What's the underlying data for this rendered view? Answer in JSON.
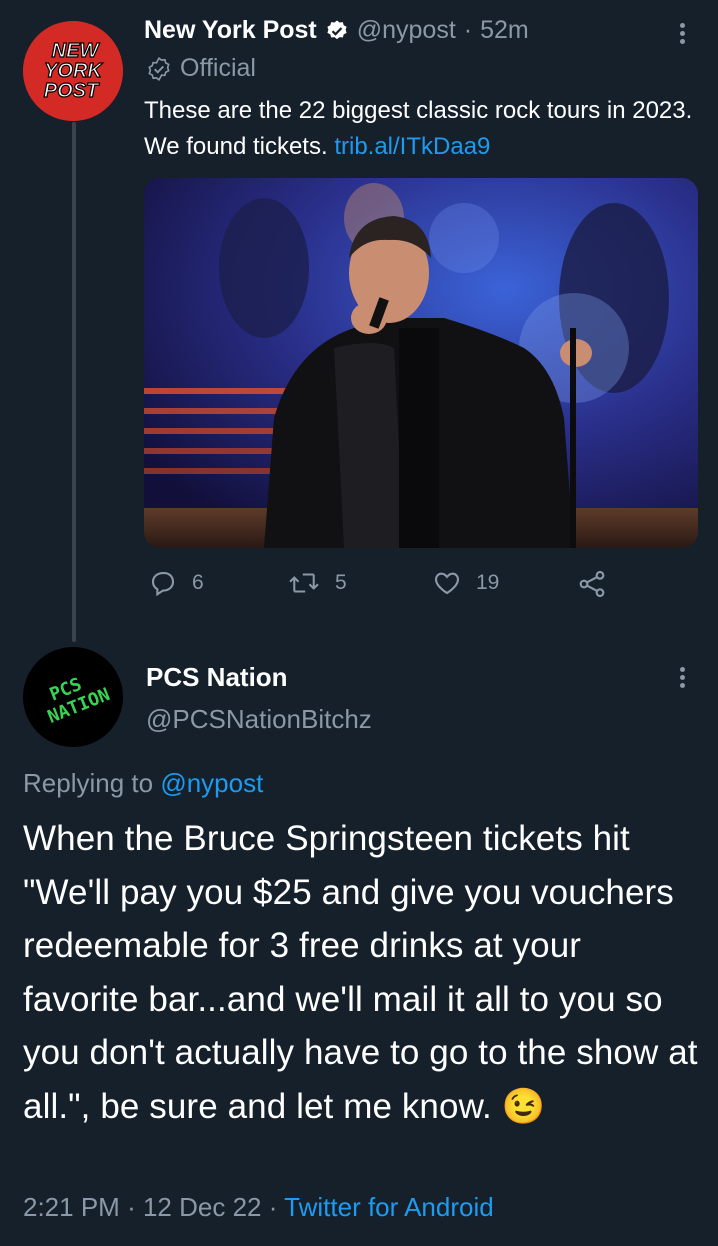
{
  "colors": {
    "background": "#15202b",
    "muted": "#8b98a5",
    "link": "#1d9bf0",
    "thread_line": "#38444d"
  },
  "parent_tweet": {
    "author_name": "New York Post",
    "verified_icon": "verified-badge-icon",
    "handle": "@nypost",
    "separator": "·",
    "time_ago": "52m",
    "official_label": "Official",
    "avatar_logo_lines": [
      "NEW",
      "YORK",
      "POST"
    ],
    "text": "These are the 22 biggest classic rock tours in 2023. We found tickets.",
    "link": "trib.al/ITkDaa9",
    "actions": {
      "replies": "6",
      "retweets": "5",
      "likes": "19"
    }
  },
  "reply_tweet": {
    "author_name": "PCS Nation",
    "handle": "@PCSNationBitchz",
    "avatar_logo_lines": [
      "PCS",
      "NATION"
    ],
    "replying_to_label": "Replying to",
    "replying_to_handle": "@nypost",
    "text": "When the Bruce Springsteen tickets hit \"We'll pay you $25 and give you vouchers redeemable for 3 free drinks at your favorite bar...and we'll mail it all to you so you don't actually have to go to the show at all.\", be sure and let me know.",
    "emoji": "😉",
    "timestamp_time": "2:21 PM",
    "timestamp_date": "12 Dec 22",
    "source": "Twitter for Android",
    "dot": "·"
  }
}
